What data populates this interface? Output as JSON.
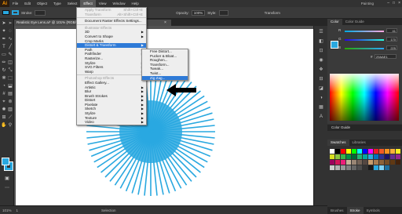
{
  "app": {
    "logo": "Ai",
    "workspace": "Painting",
    "window_controls": [
      "–",
      "□",
      "×"
    ]
  },
  "menubar": {
    "items": [
      {
        "label": "File"
      },
      {
        "label": "Edit"
      },
      {
        "label": "Object"
      },
      {
        "label": "Type"
      },
      {
        "label": "Select"
      },
      {
        "label": "Effect"
      },
      {
        "label": "View"
      },
      {
        "label": "Window"
      },
      {
        "label": "Help"
      }
    ]
  },
  "controlbar": {
    "stroke_label": "Stroke:",
    "opacity_label": "Opacity:",
    "opacity_value": "100%",
    "style_label": "Style:",
    "transform_label": "Transform"
  },
  "document": {
    "tab_title": "Realistic Eye Lens.ai* @ 101% (RGB/GPU Preview)",
    "close": "×"
  },
  "statusbar": {
    "zoom": "101%",
    "artboard": "1",
    "tool": "Selection"
  },
  "effect_menu": {
    "items": [
      {
        "label": "Apply Transform",
        "shortcut": "Shift+Ctrl+E",
        "disabled": true
      },
      {
        "label": "Transform",
        "shortcut": "Alt+Shift+Ctrl+E",
        "disabled": true
      },
      {
        "sep": true
      },
      {
        "label": "Document Raster Effects Settings..."
      },
      {
        "sep": true
      },
      {
        "label": "Illustrator Effects",
        "disabled": true
      },
      {
        "label": "3D",
        "submenu": true
      },
      {
        "label": "Convert to Shape",
        "submenu": true
      },
      {
        "label": "Crop Marks"
      },
      {
        "label": "Distort & Transform",
        "submenu": true,
        "highlight": true
      },
      {
        "label": "Path",
        "submenu": true
      },
      {
        "label": "Pathfinder",
        "submenu": true
      },
      {
        "label": "Rasterize..."
      },
      {
        "label": "Stylize",
        "submenu": true
      },
      {
        "label": "SVG Filters",
        "submenu": true
      },
      {
        "label": "Warp",
        "submenu": true
      },
      {
        "sep": true
      },
      {
        "label": "Photoshop Effects",
        "disabled": true
      },
      {
        "label": "Effect Gallery..."
      },
      {
        "label": "Artistic",
        "submenu": true
      },
      {
        "label": "Blur",
        "submenu": true
      },
      {
        "label": "Brush Strokes",
        "submenu": true
      },
      {
        "label": "Distort",
        "submenu": true
      },
      {
        "label": "Pixelate",
        "submenu": true
      },
      {
        "label": "Sketch",
        "submenu": true
      },
      {
        "label": "Stylize",
        "submenu": true
      },
      {
        "label": "Texture",
        "submenu": true
      },
      {
        "label": "Video",
        "submenu": true
      }
    ]
  },
  "distort_submenu": {
    "items": [
      {
        "label": "Free Distort..."
      },
      {
        "label": "Pucker & Bloat..."
      },
      {
        "label": "Roughen..."
      },
      {
        "label": "Transform..."
      },
      {
        "label": "Tweak..."
      },
      {
        "label": "Twist..."
      },
      {
        "label": "Zig Zag...",
        "highlight": true
      }
    ]
  },
  "color_panel": {
    "tabs": [
      "Color",
      "Color Guide"
    ],
    "sliders": [
      {
        "label": "R",
        "value": "41",
        "gradient": "linear-gradient(to right, #00a8e0, #ffa8e0)"
      },
      {
        "label": "G",
        "value": "170",
        "gradient": "linear-gradient(to right, #2900e0, #29ffe0)"
      },
      {
        "label": "B",
        "value": "225",
        "gradient": "linear-gradient(to right, #29a800, #29a8ff)"
      }
    ],
    "hex_label": "#",
    "hex_value": "29AAE1",
    "guide_header": "Color Guide"
  },
  "swatches_panel": {
    "tabs": [
      "Swatches",
      "Libraries"
    ],
    "colors": [
      "#ffffff",
      "#000000",
      "#ff0000",
      "#ffff00",
      "#00ff00",
      "#00ffff",
      "#0000ff",
      "#ff00ff",
      "#ed1c24",
      "#f15a24",
      "#f7931e",
      "#fbb03b",
      "#fcee21",
      "#d9e021",
      "#8cc63f",
      "#39b54a",
      "#009245",
      "#006837",
      "#22b573",
      "#00a99d",
      "#29abe2",
      "#0071bc",
      "#2e3192",
      "#1b1464",
      "#662d91",
      "#93278f",
      "#9e005d",
      "#d4145a",
      "#ed1e79",
      "#c7b299",
      "#998675",
      "#736357",
      "#534741",
      "#c69c6d",
      "#a67c52",
      "#8c6239",
      "#754c24",
      "#603813",
      "#42210b",
      "#cccccc",
      "#b3b3b3",
      "#999999",
      "#808080",
      "#666666",
      "#4d4d4d",
      "#333333",
      "#1a1a1a",
      "#29aae1",
      "#7fd3f5",
      "#1e6f9e"
    ]
  },
  "bottom_panel": {
    "tabs": [
      "Brushes",
      "Stroke",
      "Symbols"
    ]
  },
  "accent": "#29a8e0",
  "toolbar": {
    "icons": [
      "selection-arrow-icon",
      "direct-selection-icon",
      "magic-wand-icon",
      "lasso-icon",
      "pen-icon",
      "curvature-icon",
      "type-icon",
      "line-icon",
      "rectangle-icon",
      "paintbrush-icon",
      "pencil-icon",
      "eraser-icon",
      "rotate-icon",
      "scale-icon",
      "warp-icon",
      "free-transform-icon",
      "shape-builder-icon",
      "perspective-icon",
      "mesh-icon",
      "gradient-icon",
      "eyedropper-icon",
      "blend-icon",
      "symbol-sprayer-icon",
      "graph-icon",
      "artboard-icon",
      "slice-icon",
      "hand-icon",
      "zoom-icon"
    ]
  }
}
